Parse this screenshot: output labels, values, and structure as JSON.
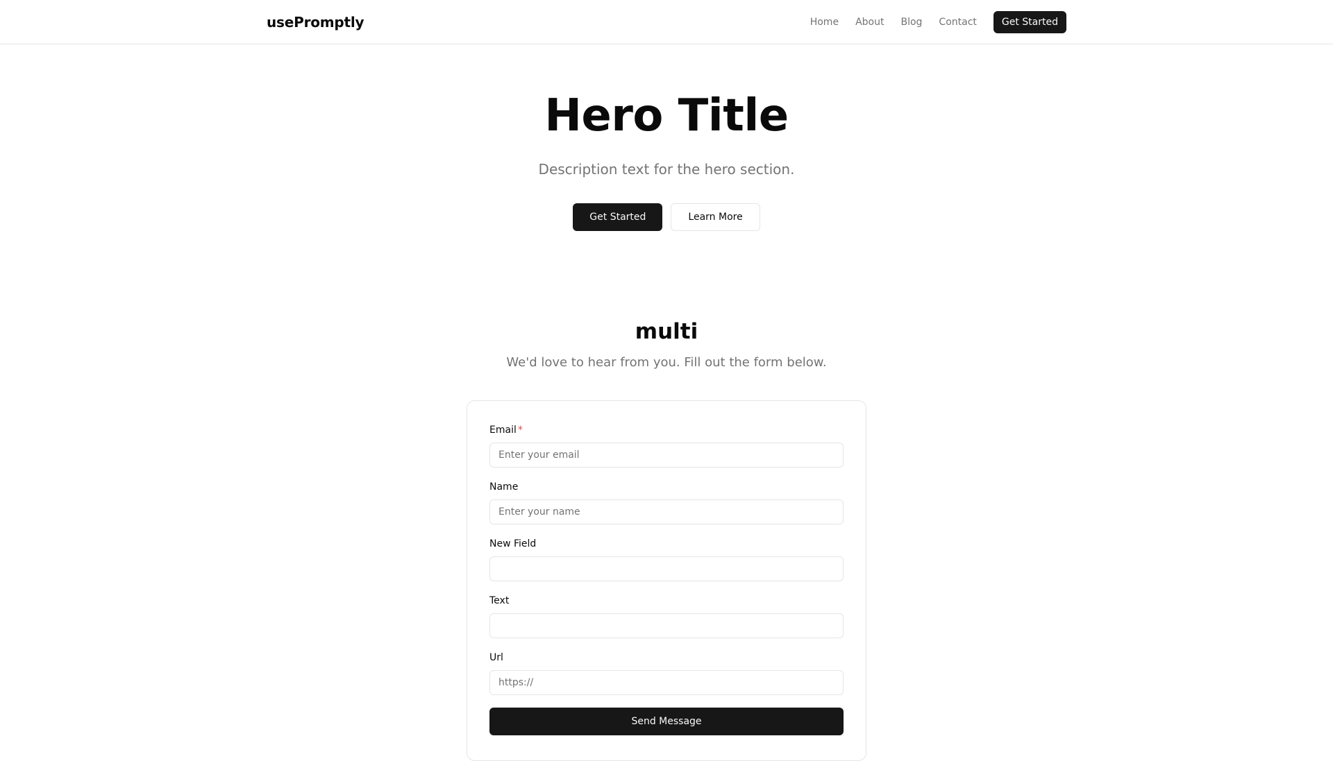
{
  "header": {
    "brand": "usePromptly",
    "nav": [
      {
        "label": "Home"
      },
      {
        "label": "About"
      },
      {
        "label": "Blog"
      },
      {
        "label": "Contact"
      }
    ],
    "cta_label": "Get Started"
  },
  "hero": {
    "title": "Hero Title",
    "description": "Description text for the hero section.",
    "primary_label": "Get Started",
    "secondary_label": "Learn More"
  },
  "contact": {
    "title": "multi",
    "description": "We'd love to hear from you. Fill out the form below.",
    "fields": [
      {
        "label": "Email",
        "required_mark": "*",
        "placeholder": "Enter your email",
        "value": ""
      },
      {
        "label": "Name",
        "placeholder": "Enter your name",
        "value": ""
      },
      {
        "label": "New Field",
        "placeholder": "",
        "value": ""
      },
      {
        "label": "Text",
        "placeholder": "",
        "value": ""
      },
      {
        "label": "Url",
        "placeholder": "https://",
        "value": ""
      }
    ],
    "submit_label": "Send Message"
  },
  "colors": {
    "primary": "#171717",
    "muted_text": "#737373",
    "border": "#e5e5e5",
    "required": "#ef4444"
  }
}
